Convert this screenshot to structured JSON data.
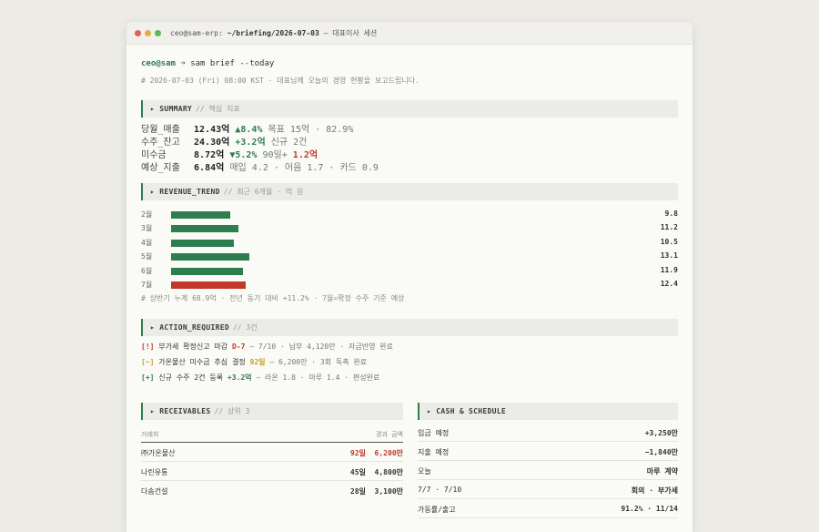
{
  "window": {
    "title_prefix": "ceo@sam-erp:",
    "title_path": "~/briefing/2026-07-03",
    "title_suffix": "— 대표이사 세션"
  },
  "command": {
    "prompt": "ceo@sam",
    "arrow": "➜",
    "text": "sam brief --today"
  },
  "header_comment": "# 2026-07-03 (Fri) 08:00 KST · 대표님께 오늘의 경영 현황을 보고드립니다.",
  "summary": {
    "title": "▸ SUMMARY",
    "comment": "// 핵심 지표",
    "rows": [
      {
        "label": "당월_매출",
        "value": "12.43억",
        "delta": "▲8.4%",
        "extra": "목표 15억 · 82.9%"
      },
      {
        "label": "수주_잔고",
        "value": "24.30억",
        "delta": "+3.2억",
        "extra": "신규 2건"
      },
      {
        "label": "미수금",
        "value": "8.72억",
        "delta": "▼5.2%",
        "extra": "90일+",
        "extra_alert": "1.2억"
      },
      {
        "label": "예상_지출",
        "value": "6.84억",
        "delta": "",
        "extra": "매입 4.2 · 어음 1.7 · 카드 0.9"
      }
    ]
  },
  "revenue_trend": {
    "title": "▸ REVENUE_TREND",
    "comment": "// 최근 6개월 · 억 원",
    "footnote": "# 상반기 누계 68.9억 · 전년 동기 대비 +11.2% · 7월=확정 수주 기준 예상"
  },
  "chart_data": {
    "type": "bar",
    "orientation": "horizontal",
    "categories": [
      "2월",
      "3월",
      "4월",
      "5월",
      "6월",
      "7월"
    ],
    "values": [
      9.8,
      11.2,
      10.5,
      13.1,
      11.9,
      12.4
    ],
    "value_labels": [
      "9.8",
      "11.2",
      "10.5",
      "13.1",
      "11.9",
      "12.4"
    ],
    "highlight_category": "7월",
    "colors": {
      "bar": "#2e7d4f",
      "highlight": "#c0392b"
    },
    "xlim": [
      0,
      15
    ]
  },
  "action_required": {
    "title": "▸ ACTION_REQUIRED",
    "comment": "// 3건",
    "items": [
      {
        "tag": "[!]",
        "text": "부가세 확정신고 마감",
        "hl": "D-7",
        "rest": "— 7/10 · 납부 4,120만 · 자금반영 완료"
      },
      {
        "tag": "[~]",
        "text": "가온물산 미수금 추심 결정",
        "hl": "92일",
        "rest": "— 6,200만 · 3회 독촉 완료"
      },
      {
        "tag": "[+]",
        "text": "신규 수주 2건 등록",
        "hl": "+3.2억",
        "rest": "— 라온 1.8 · 마루 1.4 · 편성완료"
      }
    ]
  },
  "receivables": {
    "title": "▸ RECEIVABLES",
    "comment": "// 상위 3",
    "col_client": "거래처",
    "col_right": "경과  금액",
    "rows": [
      {
        "client": "㈜가온물산",
        "days": "92일",
        "amount": "6,200만"
      },
      {
        "client": "나린유통",
        "days": "45일",
        "amount": "4,800만"
      },
      {
        "client": "다솜건설",
        "days": "28일",
        "amount": "3,100만"
      }
    ]
  },
  "cash_schedule": {
    "title": "▸ CASH & SCHEDULE",
    "rows": [
      {
        "label": "입금 예정",
        "value": "+3,250만"
      },
      {
        "label": "지출 예정",
        "value": "−1,840만"
      },
      {
        "label": "오늘",
        "value": "마루 계약"
      },
      {
        "label": "7/7 · 7/10",
        "value": "회의 · 부가세"
      },
      {
        "label": "가동률/출고",
        "value": "91.2% · 11/14"
      }
    ]
  }
}
